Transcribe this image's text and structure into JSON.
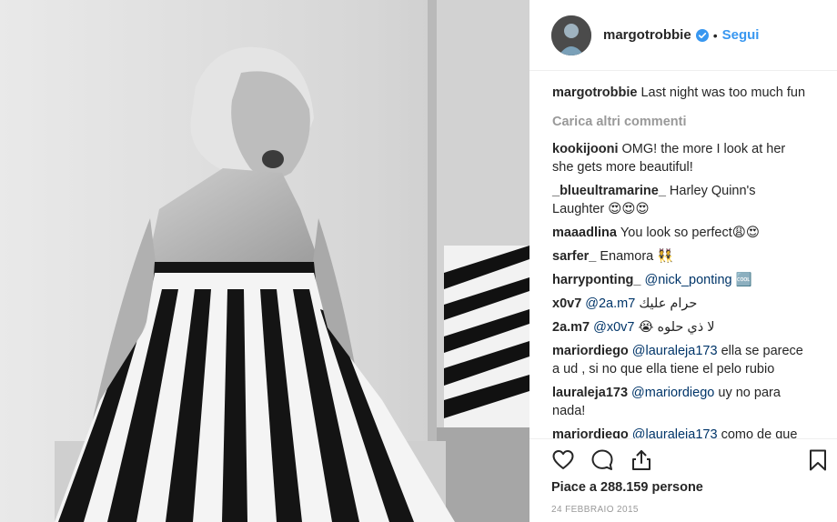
{
  "post": {
    "author": "margotrobbie",
    "follow_label": "Segui",
    "separator": "•",
    "caption_user": "margotrobbie",
    "caption_text": "Last night was too much fun",
    "load_more": "Carica altri commenti",
    "likes": "Piace a 288.159 persone",
    "date": "24 FEBBRAIO 2015"
  },
  "comments": [
    {
      "user": "kookijooni",
      "mention": "",
      "text": "OMG! the more I look at her she gets more beautiful!"
    },
    {
      "user": "_blueultramarine_",
      "mention": "",
      "text": "Harley Quinn's Laughter 😍😍😍"
    },
    {
      "user": "maaadlina",
      "mention": "",
      "text": "You look so perfect😩😍"
    },
    {
      "user": "sarfer_",
      "mention": "",
      "text": "Enamora 👯"
    },
    {
      "user": "harryponting_",
      "mention": "@nick_ponting",
      "text": "🆒"
    },
    {
      "user": "x0v7",
      "mention": "@2a.m7",
      "text": "حرام عليك"
    },
    {
      "user": "2a.m7",
      "mention": "@x0v7",
      "text": "لا ذي حلوه 😭"
    },
    {
      "user": "mariordiego",
      "mention": "@lauraleja173",
      "text": "ella se parece a ud , si no que ella tiene el pelo rubio"
    },
    {
      "user": "lauraleja173",
      "mention": "@mariordiego",
      "text": "uy no para nada!"
    },
    {
      "user": "mariordiego",
      "mention": "@lauraleja173",
      "text": "como de que"
    }
  ],
  "icons": {
    "like": "heart-icon",
    "comment": "comment-icon",
    "share": "share-icon",
    "save": "bookmark-icon",
    "verified": "verified-badge-icon"
  },
  "colors": {
    "link": "#3897f0",
    "verified": "#3897f0",
    "muted": "#999999",
    "text": "#262626"
  }
}
